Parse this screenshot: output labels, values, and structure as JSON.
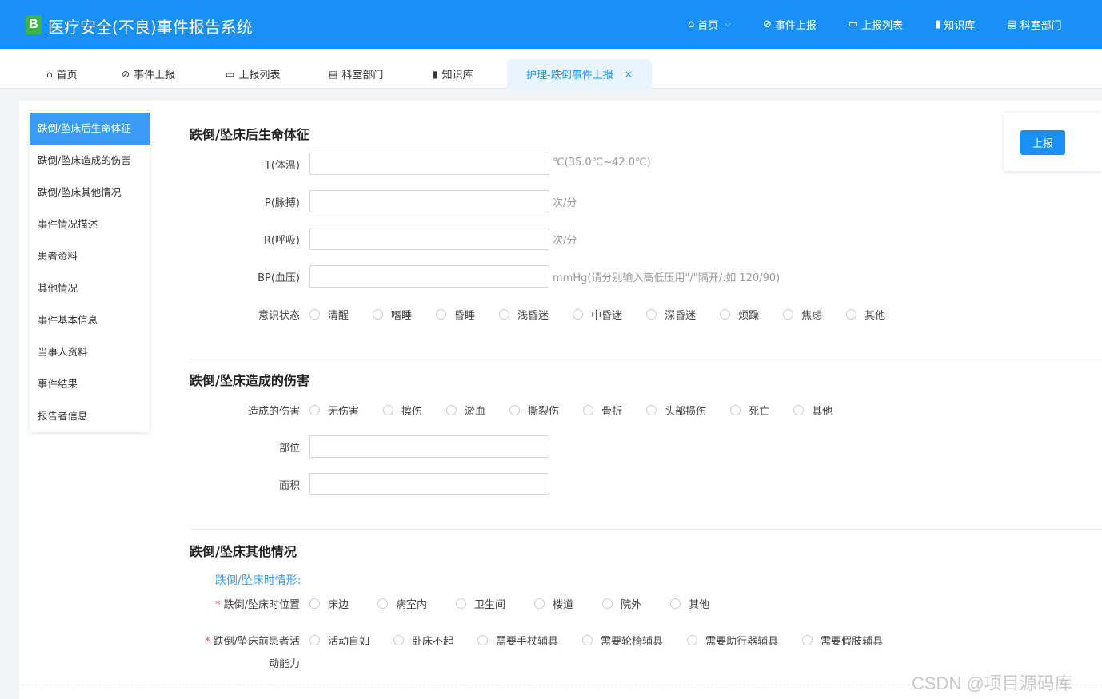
{
  "app": {
    "logo_letter": "B",
    "title": "医疗安全(不良)事件报告系统"
  },
  "topnav": [
    {
      "icon": "⌂",
      "label": "首页",
      "chevron": "⌵"
    },
    {
      "icon": "⊘",
      "label": "事件上报"
    },
    {
      "icon": "▭",
      "label": "上报列表"
    },
    {
      "icon": "▮",
      "label": "知识库"
    },
    {
      "icon": "▤",
      "label": "科室部门"
    }
  ],
  "tabs": [
    {
      "icon": "⌂",
      "label": "首页"
    },
    {
      "icon": "⊘",
      "label": "事件上报"
    },
    {
      "icon": "▭",
      "label": "上报列表"
    },
    {
      "icon": "▤",
      "label": "科室部门"
    },
    {
      "icon": "▮",
      "label": "知识库"
    },
    {
      "label": "护理-跌倒事件上报",
      "close": "×"
    }
  ],
  "side_menu": [
    "跌倒/坠床后生命体征",
    "跌倒/坠床造成的伤害",
    "跌倒/坠床其他情况",
    "事件情况描述",
    "患者资料",
    "其他情况",
    "事件基本信息",
    "当事人资料",
    "事件结果",
    "报告者信息"
  ],
  "report_button": "上报",
  "section1": {
    "title": "跌倒/坠床后生命体征",
    "temp": {
      "label": "T(体温)",
      "unit": "℃(35.0℃~42.0℃)",
      "value": ""
    },
    "pulse": {
      "label": "P(脉搏)",
      "unit": "次/分",
      "value": ""
    },
    "resp": {
      "label": "R(呼吸)",
      "unit": "次/分",
      "value": ""
    },
    "bp": {
      "label": "BP(血压)",
      "unit": "mmHg(请分别输入高低压用\"/\"隔开/.如 120/90)",
      "value": ""
    },
    "consciousness": {
      "label": "意识状态",
      "options": [
        "清醒",
        "嗜睡",
        "昏睡",
        "浅昏迷",
        "中昏迷",
        "深昏迷",
        "烦躁",
        "焦虑",
        "其他"
      ]
    }
  },
  "section2": {
    "title": "跌倒/坠床造成的伤害",
    "injury": {
      "label": "造成的伤害",
      "options": [
        "无伤害",
        "擦伤",
        "淤血",
        "撕裂伤",
        "骨折",
        "头部损伤",
        "死亡",
        "其他"
      ]
    },
    "site": {
      "label": "部位",
      "value": ""
    },
    "area": {
      "label": "面积",
      "value": ""
    }
  },
  "section3": {
    "title": "跌倒/坠床其他情况",
    "subhead": "跌倒/坠床时情形:",
    "location": {
      "required_mark": "*",
      "label": "跌倒/坠床时位置",
      "options": [
        "床边",
        "病室内",
        "卫生间",
        "楼道",
        "院外",
        "其他"
      ]
    },
    "mobility": {
      "required_mark": "*",
      "label_line1": "跌倒/坠床前患者活",
      "label_line2": "动能力",
      "options": [
        "活动自如",
        "卧床不起",
        "需要手杖辅具",
        "需要轮椅辅具",
        "需要助行器辅具",
        "需要假肢辅具"
      ]
    }
  },
  "watermark": "CSDN @项目源码库"
}
